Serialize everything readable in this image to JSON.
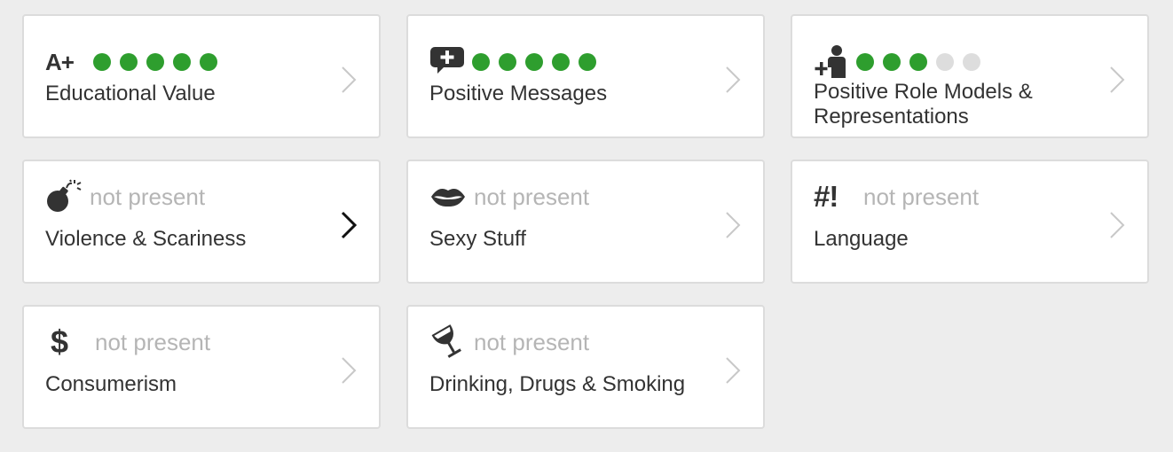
{
  "colors": {
    "dot_on": "#2e9e2e",
    "dot_off": "#dddddd",
    "muted": "#b5b5b5",
    "text": "#333333",
    "chevron_active": "#111111",
    "chevron": "#c8c8c8"
  },
  "cards": [
    {
      "icon": "a-plus-icon",
      "icon_text": "A+",
      "rating": 5,
      "max": 5,
      "label": "Educational Value"
    },
    {
      "icon": "speech-bubble-plus-icon",
      "rating": 5,
      "max": 5,
      "label": "Positive Messages"
    },
    {
      "icon": "role-model-plus-icon",
      "rating": 3,
      "max": 5,
      "label": "Positive Role Models & Representations"
    },
    {
      "icon": "bomb-icon",
      "status": "not present",
      "label": "Violence & Scariness",
      "active": true
    },
    {
      "icon": "lips-icon",
      "status": "not present",
      "label": "Sexy Stuff"
    },
    {
      "icon": "hash-exclaim-icon",
      "icon_text": "#!",
      "status": "not present",
      "label": "Language"
    },
    {
      "icon": "dollar-icon",
      "icon_text": "$",
      "status": "not present",
      "label": "Consumerism"
    },
    {
      "icon": "wine-glass-icon",
      "status": "not present",
      "label": "Drinking, Drugs & Smoking"
    }
  ]
}
